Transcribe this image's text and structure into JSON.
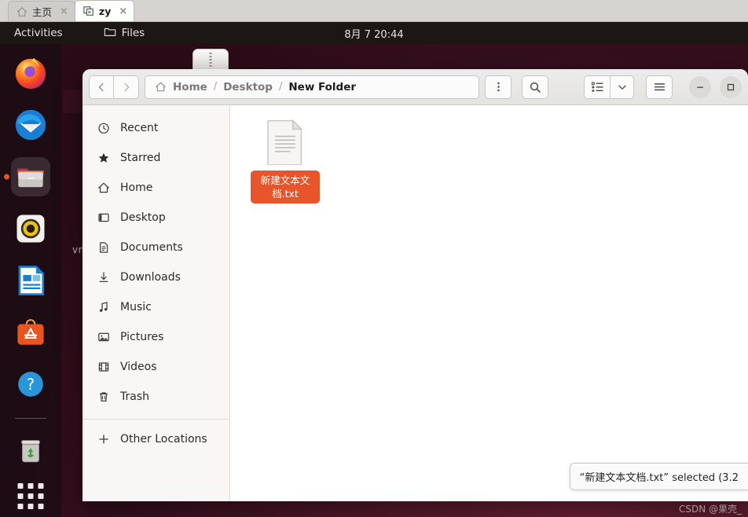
{
  "browser_tabs": [
    {
      "label": "主页",
      "icon": "home-icon",
      "active": false,
      "close": "×"
    },
    {
      "label": "zy",
      "icon": "vnc-screen-icon",
      "active": true,
      "close": "×"
    }
  ],
  "topbar": {
    "activities": "Activities",
    "app_name": "Files",
    "app_icon": "folder-icon",
    "clock": "8月 7  20:44"
  },
  "desktop": {
    "label_text": "vn"
  },
  "dock": {
    "items": [
      {
        "name": "firefox",
        "label": "Firefox",
        "running": false
      },
      {
        "name": "thunderbird",
        "label": "Thunderbird",
        "running": false
      },
      {
        "name": "files",
        "label": "Files",
        "running": true
      },
      {
        "name": "rhythmbox",
        "label": "Rhythmbox",
        "running": false
      },
      {
        "name": "libreoffice-writer",
        "label": "LibreOffice Writer",
        "running": false
      },
      {
        "name": "ubuntu-software",
        "label": "Ubuntu Software",
        "running": false
      },
      {
        "name": "help",
        "label": "Help",
        "running": false
      },
      {
        "name": "trash",
        "label": "Trash",
        "running": false
      }
    ],
    "show_apps_label": "Show Applications"
  },
  "window": {
    "nav": {
      "back": "‹",
      "forward": "›"
    },
    "breadcrumb": {
      "home_icon": "home-icon",
      "items": [
        "Home",
        "Desktop",
        "New Folder"
      ],
      "separator": "/"
    },
    "buttons": {
      "menu": "menu-kebab-button",
      "search": "search-button",
      "view_list": "list-view-button",
      "view_dropdown": "view-options-button",
      "hamburger": "main-menu-button",
      "minimize": "—",
      "maximize": "□"
    },
    "sidebar": {
      "items": [
        {
          "label": "Recent",
          "icon": "clock-icon"
        },
        {
          "label": "Starred",
          "icon": "star-icon"
        },
        {
          "label": "Home",
          "icon": "home-icon"
        },
        {
          "label": "Desktop",
          "icon": "desktop-icon"
        },
        {
          "label": "Documents",
          "icon": "document-icon"
        },
        {
          "label": "Downloads",
          "icon": "download-icon"
        },
        {
          "label": "Music",
          "icon": "music-note-icon"
        },
        {
          "label": "Pictures",
          "icon": "image-icon"
        },
        {
          "label": "Videos",
          "icon": "film-icon"
        },
        {
          "label": "Trash",
          "icon": "trash-icon"
        }
      ],
      "other_locations": {
        "label": "Other Locations",
        "icon": "plus-icon"
      }
    },
    "files": [
      {
        "name": "新建文本文档.txt",
        "icon": "text-file-icon",
        "selected": true
      }
    ],
    "status": "“新建文本文档.txt” selected (3.2",
    "colors": {
      "selection": "#e9552a",
      "accent": "#e95420"
    }
  },
  "watermark": "CSDN @果壳_"
}
